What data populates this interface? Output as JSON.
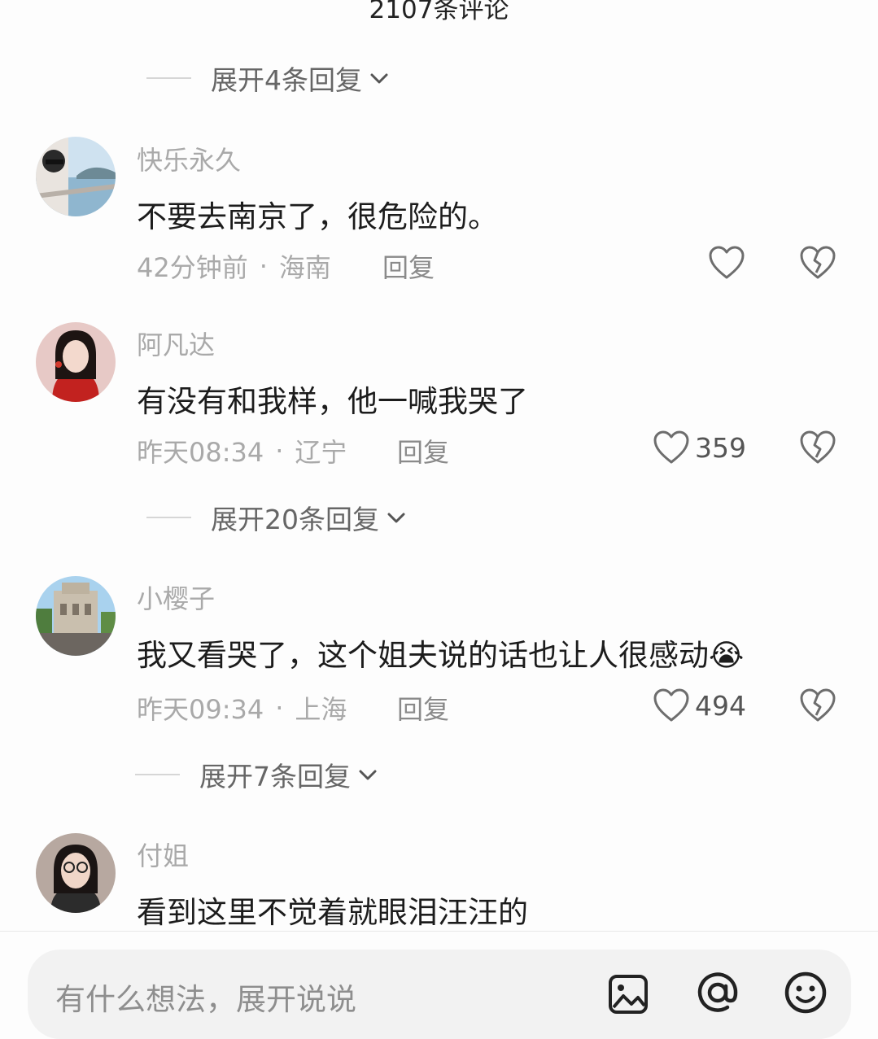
{
  "header": {
    "title": "2107条评论"
  },
  "expand_replies": [
    {
      "label": "展开4条回复"
    },
    {
      "label": "展开20条回复"
    },
    {
      "label": "展开7条回复"
    }
  ],
  "comments": [
    {
      "username": "快乐永久",
      "text": "不要去南京了，很危险的。",
      "time": "42分钟前",
      "location": "海南",
      "reply_label": "回复",
      "likes": "",
      "avatar_icon": "avatar-photo-sea"
    },
    {
      "username": "阿凡达",
      "text": "有没有和我样，他一喊我哭了",
      "time": "昨天08:34",
      "location": "辽宁",
      "reply_label": "回复",
      "likes": "359",
      "avatar_icon": "avatar-photo-woman-red"
    },
    {
      "username": "小樱子",
      "text": "我又看哭了，这个姐夫说的话也让人很感动",
      "emoji": "😭",
      "time": "昨天09:34",
      "location": "上海",
      "reply_label": "回复",
      "likes": "494",
      "avatar_icon": "avatar-photo-landmark"
    },
    {
      "username": "付姐",
      "text": "看到这里不觉着就眼泪汪汪的",
      "avatar_icon": "avatar-photo-woman-glasses"
    }
  ],
  "separator": "·",
  "input": {
    "placeholder": "有什么想法，展开说说"
  },
  "input_icons": [
    "image-icon",
    "at-icon",
    "emoji-icon"
  ],
  "colors": {
    "background": "#fdfdfd",
    "meta_text": "#a9a9a9",
    "input_bg": "#f2f2f2"
  }
}
